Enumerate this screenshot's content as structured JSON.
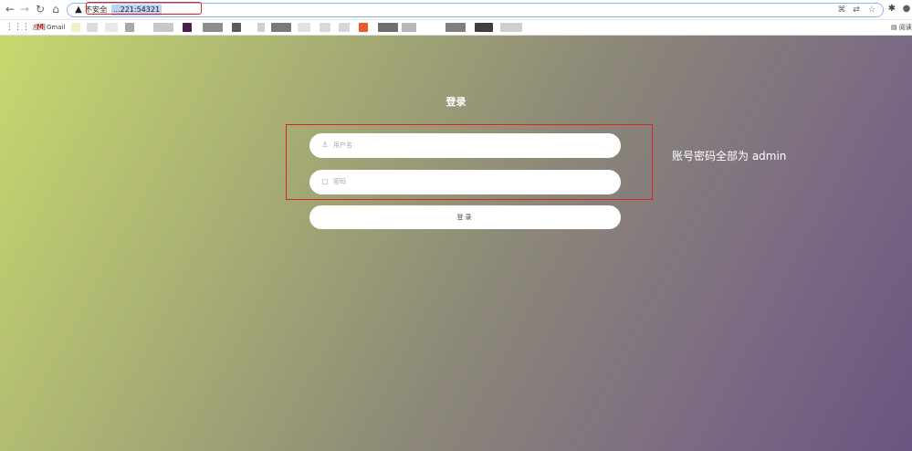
{
  "browser": {
    "nav": {
      "back_glyph": "←",
      "forward_glyph": "→",
      "reload_glyph": "↻",
      "home_glyph": "⌂"
    },
    "address_bar": {
      "security_glyph": "▲",
      "security_label": "不安全",
      "url": "...221:54321",
      "right_glyphs": [
        "⌘",
        "⇄",
        "☆"
      ]
    },
    "extensions": {
      "puzzle_glyph": "✱",
      "profile_glyph": "●"
    },
    "bookmarks": {
      "apps_glyph": "⋮⋮⋮",
      "apps_label": "应用",
      "gmail_glyph": "M",
      "gmail_label": "Gmail",
      "reading_list_glyph": "▤",
      "reading_list_label": "阅读"
    }
  },
  "login": {
    "title": "登录",
    "username_icon": "♙",
    "username_placeholder": "用户名",
    "password_icon": "▢",
    "password_placeholder": "密码",
    "submit_label": "登录"
  },
  "annotation": {
    "text": "账号密码全部为 admin"
  },
  "colors": {
    "highlight": "#e0241d",
    "gradient_start": "#c8d86e",
    "gradient_end": "#6a5580"
  }
}
